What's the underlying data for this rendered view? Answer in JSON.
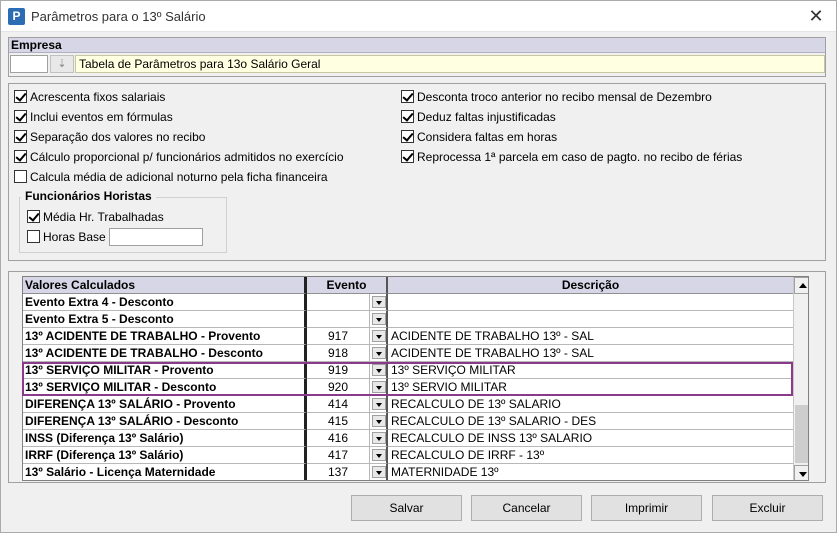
{
  "window": {
    "title": "Parâmetros para o 13º Salário",
    "app_icon_letter": "P",
    "close_glyph": "✕"
  },
  "empresa": {
    "header": "Empresa",
    "code": "",
    "lookup_glyph": "⇣",
    "name": "Tabela de Parâmetros para 13o Salário Geral"
  },
  "options": {
    "left": [
      {
        "label": "Acrescenta fixos salariais",
        "checked": true
      },
      {
        "label": "Inclui eventos em fórmulas",
        "checked": true
      },
      {
        "label": "Separação dos valores no recibo",
        "checked": true
      },
      {
        "label": "Cálculo proporcional p/ funcionários admitidos no exercício",
        "checked": true
      },
      {
        "label": "Calcula média de adicional noturno pela ficha financeira",
        "checked": false
      }
    ],
    "right": [
      {
        "label": "Desconta troco anterior no recibo mensal de Dezembro",
        "checked": true
      },
      {
        "label": "Deduz faltas injustificadas",
        "checked": true
      },
      {
        "label": "Considera faltas em horas",
        "checked": true
      },
      {
        "label": "Reprocessa 1ª parcela em caso de pagto. no recibo de férias",
        "checked": true
      }
    ],
    "horistas": {
      "title": "Funcionários Horistas",
      "media_label": "Média Hr. Trabalhadas",
      "media_checked": true,
      "horas_base_label": "Horas Base",
      "horas_base_checked": false,
      "horas_base_value": ""
    }
  },
  "grid": {
    "headers": [
      "Valores Calculados",
      "Evento",
      "Descrição"
    ],
    "rows": [
      {
        "name": "Evento Extra 4 - Desconto",
        "evento": "",
        "descricao": ""
      },
      {
        "name": "Evento Extra 5 - Desconto",
        "evento": "",
        "descricao": ""
      },
      {
        "name": "13º ACIDENTE DE TRABALHO - Provento",
        "evento": "917",
        "descricao": "ACIDENTE DE TRABALHO 13º - SAL"
      },
      {
        "name": "13º ACIDENTE DE TRABALHO - Desconto",
        "evento": "918",
        "descricao": "ACIDENTE DE TRABALHO 13º - SAL"
      },
      {
        "name": "13º SERVIÇO MILITAR - Provento",
        "evento": "919",
        "descricao": "13º SERVIÇO MILITAR"
      },
      {
        "name": "13º SERVIÇO MILITAR - Desconto",
        "evento": "920",
        "descricao": "13º SERVIO MILITAR"
      },
      {
        "name": "DIFERENÇA 13º SALÁRIO - Provento",
        "evento": "414",
        "descricao": "RECALCULO DE 13º SALARIO"
      },
      {
        "name": "DIFERENÇA 13º SALÁRIO - Desconto",
        "evento": "415",
        "descricao": "RECALCULO DE 13º SALARIO - DES"
      },
      {
        "name": "INSS (Diferença 13º Salário)",
        "evento": "416",
        "descricao": "RECALCULO DE INSS 13º SALARIO"
      },
      {
        "name": "IRRF (Diferença 13º Salário)",
        "evento": "417",
        "descricao": "RECALCULO DE IRRF - 13º"
      },
      {
        "name": "13º Salário - Licença Maternidade",
        "evento": "137",
        "descricao": "MATERNIDADE 13º"
      }
    ]
  },
  "buttons": {
    "salvar": "Salvar",
    "cancelar": "Cancelar",
    "imprimir": "Imprimir",
    "excluir": "Excluir"
  },
  "colors": {
    "highlight_border": "#8b3a8b",
    "header_bg": "#d6d6e6",
    "empresa_name_bg": "#ffffe1"
  }
}
